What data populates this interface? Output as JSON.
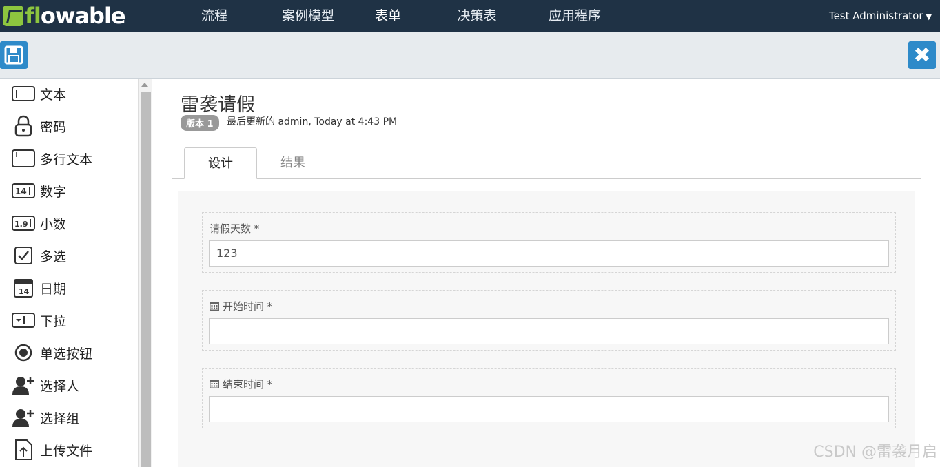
{
  "app": {
    "logo_text": "flowable"
  },
  "nav": {
    "items": [
      {
        "label": "流程"
      },
      {
        "label": "案例模型"
      },
      {
        "label": "表单"
      },
      {
        "label": "决策表"
      },
      {
        "label": "应用程序"
      }
    ],
    "active": "表单",
    "user": "Test Administrator"
  },
  "palette": {
    "items": [
      {
        "label": "文本",
        "icon": "text-field-icon"
      },
      {
        "label": "密码",
        "icon": "lock-icon"
      },
      {
        "label": "多行文本",
        "icon": "multiline-text-icon"
      },
      {
        "label": "数字",
        "icon": "number-icon"
      },
      {
        "label": "小数",
        "icon": "decimal-icon"
      },
      {
        "label": "多选",
        "icon": "checkbox-icon"
      },
      {
        "label": "日期",
        "icon": "calendar-icon"
      },
      {
        "label": "下拉",
        "icon": "dropdown-icon"
      },
      {
        "label": "单选按钮",
        "icon": "radio-icon"
      },
      {
        "label": "选择人",
        "icon": "add-person-icon"
      },
      {
        "label": "选择组",
        "icon": "add-group-icon"
      },
      {
        "label": "上传文件",
        "icon": "upload-icon"
      }
    ]
  },
  "form": {
    "title": "雷袭请假",
    "version_badge": "版本 1",
    "updated": "最后更新的 admin, Today at 4:43 PM",
    "tabs": [
      {
        "label": "设计"
      },
      {
        "label": "结果"
      }
    ],
    "fields": [
      {
        "label": "请假天数 *",
        "value": "123",
        "icon": ""
      },
      {
        "label": "开始时间 *",
        "value": "",
        "icon": "calendar-icon"
      },
      {
        "label": "结束时间 *",
        "value": "",
        "icon": "calendar-icon"
      }
    ]
  },
  "watermark": "CSDN @雷袭月启",
  "colors": {
    "topbar": "#1f3245",
    "accent": "#2e8ac9",
    "logo_green": "#8dc63f"
  }
}
